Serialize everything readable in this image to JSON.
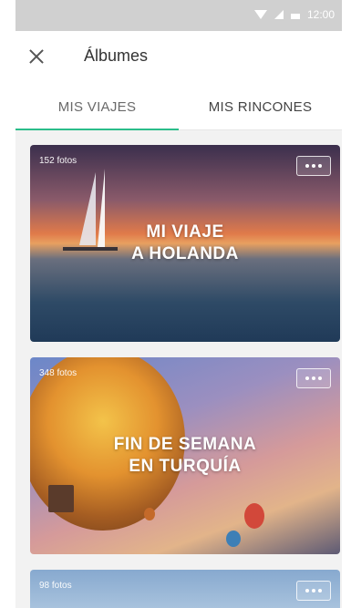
{
  "status_bar": {
    "time": "12:00"
  },
  "app_bar": {
    "title": "Álbumes"
  },
  "tabs": [
    {
      "label": "MIS VIAJES",
      "active": true
    },
    {
      "label": "MIS RINCONES",
      "active": false
    }
  ],
  "albums": [
    {
      "count": "152 fotos",
      "title_line1": "MI VIAJE",
      "title_line2": "A HOLANDA"
    },
    {
      "count": "348 fotos",
      "title_line1": "FIN DE SEMANA",
      "title_line2": "EN TURQUÍA"
    },
    {
      "count": "98 fotos",
      "title_line1": "",
      "title_line2": ""
    }
  ],
  "colors": {
    "accent": "#2bbd8a",
    "status_bar": "#d0d0d0"
  },
  "icons": {
    "close": "close-icon",
    "more": "more-options-icon"
  }
}
